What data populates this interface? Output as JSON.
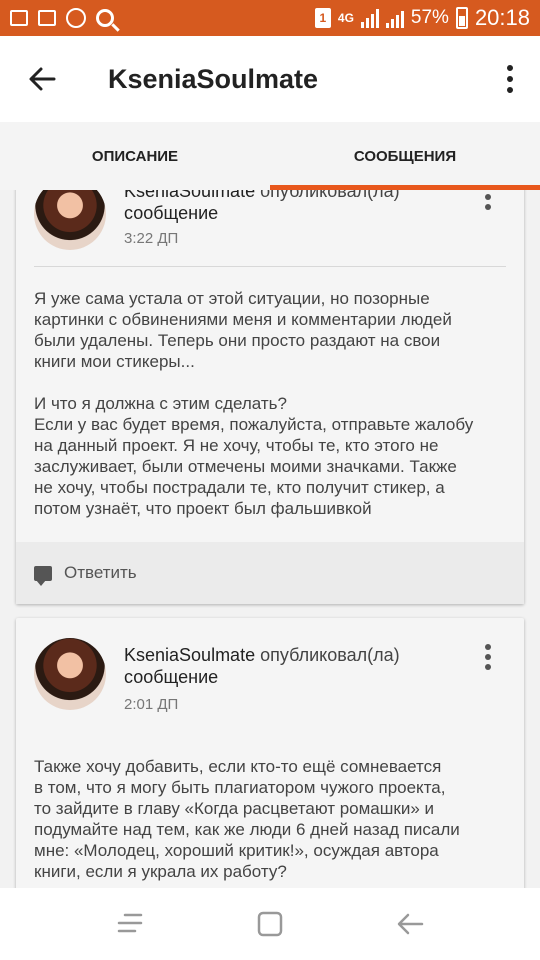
{
  "status_bar": {
    "network": "4G",
    "battery": "57%",
    "time": "20:18",
    "sim": "1"
  },
  "app_bar": {
    "title": "KseniaSoulmate"
  },
  "tabs": [
    {
      "label": "ОПИСАНИЕ",
      "active": false
    },
    {
      "label": "СООБЩЕНИЯ",
      "active": true
    }
  ],
  "posts": [
    {
      "author": "KseniaSoulmate",
      "action": "опубликовал(ла)",
      "object": "сообщение",
      "time": "3:22 ДП",
      "message": "Я уже сама устала от этой ситуации, но позорные\nкартинки с обвинениями меня и комментарии людей\nбыли удалены. Теперь они просто раздают на свои\nкниги мои стикеры...\n\nИ что я должна с этим сделать?\nЕсли у вас будет время, пожалуйста, отправьте жалобу\nна данный проект. Я не хочу, чтобы те, кто этого не\nзаслуживает, были отмечены моими значками. Также\nне хочу, чтобы пострадали те, кто получит стикер, а\nпотом узнаёт, что проект был фальшивкой",
      "reply_label": "Ответить"
    },
    {
      "author": "KseniaSoulmate",
      "action": "опубликовал(ла)",
      "object": "сообщение",
      "time": "2:01 ДП",
      "message": "Также хочу добавить, если кто-то ещё сомневается\nв том, что я могу быть плагиатором чужого проекта,\nто зайдите в главу «Когда расцветают ромашки» и\nподумайте над тем, как же люди 6 дней назад писали\nмне: «Молодец, хороший критик!», осуждая автора\nкниги, если я украла их работу?"
    }
  ],
  "colors": {
    "accent": "#e8571c",
    "status_bar": "#d65a1f"
  }
}
